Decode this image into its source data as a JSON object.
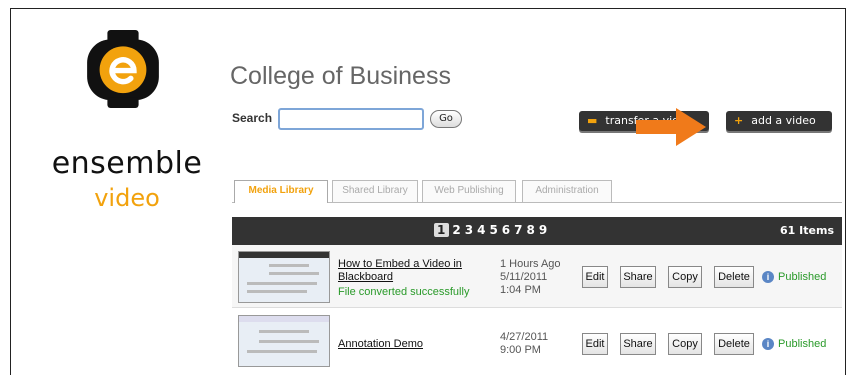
{
  "brand": {
    "line1": "ensemble",
    "line2": "video"
  },
  "header": {
    "title": "College of Business"
  },
  "search": {
    "label": "Search",
    "value": "",
    "go_label": "Go"
  },
  "actions": {
    "transfer_label": "transfer a video",
    "add_label": "add a video",
    "plus": "+"
  },
  "tabs": [
    {
      "label": "Media Library",
      "active": true
    },
    {
      "label": "Shared Library",
      "active": false
    },
    {
      "label": "Web Publishing",
      "active": false
    },
    {
      "label": "Administration",
      "active": false
    }
  ],
  "pagination": {
    "pages": [
      "1",
      "2",
      "3",
      "4",
      "5",
      "6",
      "7",
      "8",
      "9"
    ],
    "current": "1",
    "count": "61 Items"
  },
  "videos": [
    {
      "title": "How to Embed a Video in Blackboard",
      "status": "File converted successfully",
      "date_line1": "1 Hours Ago",
      "date_line2": "5/11/2011",
      "date_line3": "1:04 PM",
      "published": "Published"
    },
    {
      "title": "Annotation Demo",
      "status": "",
      "date_line1": "4/27/2011",
      "date_line2": "9:00 PM",
      "date_line3": "",
      "published": "Published"
    }
  ],
  "row_buttons": {
    "edit": "Edit",
    "share": "Share",
    "copy": "Copy",
    "delete": "Delete"
  },
  "colors": {
    "accent": "#f2a20d",
    "arrow": "#f07a1a",
    "published": "#2a9a2a",
    "bar": "#333333"
  }
}
